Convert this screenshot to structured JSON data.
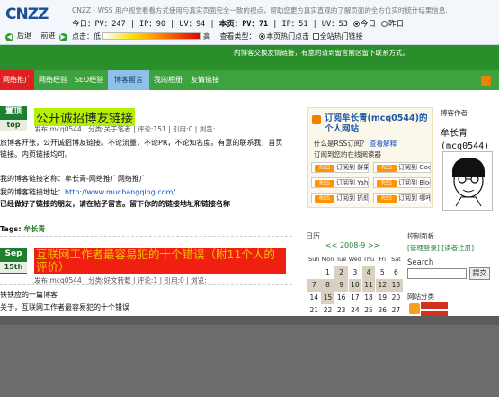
{
  "cnzz": {
    "logo_text": "CNZZ",
    "notice": "CNZZ - WSS 用户视觉看看方式使用与真实页面完全一致的视点，帮助您更方真实直观的了解页面的全方位实时统计结果信息.",
    "back_label": "后退",
    "forward_label": "前进",
    "stats_today": "今日：PV：247",
    "stats_ip_today": "IP：90",
    "stats_uv_today": "UV：94",
    "stats_page": "本页：PV：71",
    "stats_ip_page": "IP：51",
    "stats_uv_page": "UV：53",
    "today_radio": "今日",
    "yesterday_radio": "昨日",
    "click_label": "点击：低",
    "click_high": "高",
    "view_type": "查看类型：",
    "opt1": "本页热门点击",
    "opt2": "全站热门链接"
  },
  "site": {
    "header_info": "内博客交换友情链接，有意的请到留言前区留下联系方式。",
    "nav": [
      {
        "label": "网络推广"
      },
      {
        "label": "网络经验"
      },
      {
        "label": "SEO经验"
      },
      {
        "label": "博客留言"
      },
      {
        "label": "我的相册"
      },
      {
        "label": "友情链接"
      }
    ]
  },
  "post1": {
    "badge_top": "置顶",
    "badge_bottom": "top",
    "title": "公开诚招博友链接",
    "meta": "发布:mcq0544 | 分类:关于笔者 | 评论:151 | 引用:0 | 浏览:",
    "line1": "旅博客开张，公开诚招博友链接。不论流量，不论PR，不论知名度。有意的联系我，首页",
    "line2": "链接。内页链接均可。",
    "line3": "我的博客链接名称：牟长青-网络推广网络推广",
    "line4": "我的博客链接地址：",
    "line4_link": "http://www.muchangqing.com/",
    "line5": "已经做好了链接的朋友，请在帖子留言。留下你的的链接地址和链接名称",
    "tags_label": "Tags:",
    "tags_value": "牟长青"
  },
  "post2": {
    "badge_top": "Sep",
    "badge_bottom": "15th",
    "title": "互联网工作者最容易犯的十个错误（附11个人的评价）",
    "meta": "发布:mcq0544 | 分类:好文转载 | 评论:1 | 引用:0 | 浏览:",
    "line1": "铁铁应的一篇博客",
    "line2": "关于，互联网工作者最容易犯的十个错误"
  },
  "rss": {
    "title": "订阅牟长青(mcq0544)的个人网站",
    "q1": "什么是RSS订阅？",
    "q1_link": "查看解释",
    "q2": "订阅到您的在线阅读器",
    "buttons": [
      "订阅到 鲜果",
      "订阅到 Google",
      "订阅到 Yahoo!",
      "订阅到 Bloglines",
      "订阅到 抓虾",
      "订阅到 哪吒"
    ]
  },
  "author": {
    "heading": "博客作者",
    "name_cn": "牟长青",
    "name_id": "(mcq0544)"
  },
  "calendar": {
    "heading": "日历",
    "month_nav": "<< 2008-9 >>",
    "weekdays": [
      "Sun",
      "Mon",
      "Tue",
      "Wed",
      "Thu",
      "Fri",
      "Sat"
    ],
    "rows": [
      [
        "",
        "1",
        "2",
        "3",
        "4",
        "5",
        "6"
      ],
      [
        "7",
        "8",
        "9",
        "10",
        "11",
        "12",
        "13"
      ],
      [
        "14",
        "15",
        "16",
        "17",
        "18",
        "19",
        "20"
      ],
      [
        "21",
        "22",
        "23",
        "24",
        "25",
        "26",
        "27"
      ]
    ]
  },
  "panel": {
    "heading": "控制面板",
    "admin_link": "[管理登录]",
    "register_link": "[读者注册]",
    "search_label": "Search",
    "search_button": "提交",
    "categories": "网站分类"
  }
}
